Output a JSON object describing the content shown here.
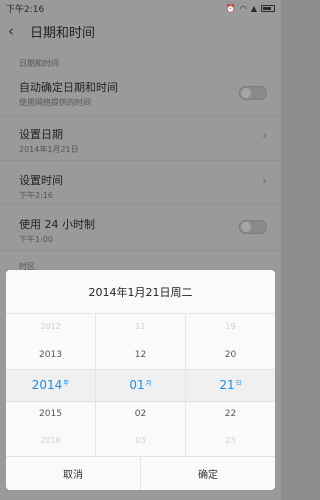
{
  "status": {
    "time": "下午2:16",
    "icons": [
      "alarm-icon",
      "wifi-icon",
      "signal-icon",
      "battery-icon"
    ]
  },
  "header": {
    "title": "日期和时间"
  },
  "section": {
    "label": "日期和时间"
  },
  "rows": [
    {
      "main": "自动确定日期和时间",
      "sub": "使用网络提供的时间"
    },
    {
      "main": "设置日期",
      "sub": "2014年1月21日"
    },
    {
      "main": "设置时间",
      "sub": "下午2:16"
    },
    {
      "main": "使用 24 小时制",
      "sub": "下午1:00"
    }
  ],
  "section2": {
    "label": "时区"
  },
  "dialog": {
    "title": "2014年1月21日周二",
    "year": {
      "far_prev": "2012",
      "prev": "2013",
      "selected": "2014",
      "unit": "年",
      "next": "2015",
      "far_next": "2016"
    },
    "month": {
      "far_prev": "11",
      "prev": "12",
      "selected": "01",
      "unit": "月",
      "next": "02",
      "far_next": "03"
    },
    "day": {
      "far_prev": "19",
      "prev": "20",
      "selected": "21",
      "unit": "日",
      "next": "22",
      "far_next": "23"
    },
    "cancel": "取消",
    "confirm": "确定"
  },
  "colors": {
    "accent": "#1e8ee0"
  }
}
